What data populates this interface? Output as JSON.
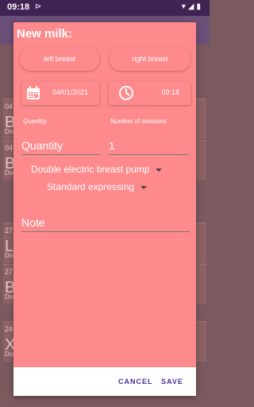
{
  "status": {
    "time": "09:18",
    "notif": "⊳"
  },
  "background_rows": [
    {
      "small": "04",
      "big": "B",
      "sub": "Dou"
    },
    {
      "small": "04",
      "big": "B",
      "sub": "Dou"
    },
    {
      "small": "27",
      "big": "L",
      "sub": "Dou"
    },
    {
      "small": "27",
      "big": "B",
      "sub": "Dou"
    },
    {
      "small": "24",
      "big": "X",
      "sub": "Dou"
    }
  ],
  "dialog": {
    "title": "New milk:",
    "left_breast": "left breast",
    "right_breast": "right breast",
    "date": "04/01/2021",
    "time": "09:18",
    "quantity_label": "Quantity",
    "sessions_label": "Number of sessions",
    "quantity_placeholder": "Quantity",
    "sessions_value": "1",
    "pump_selected": "Double electric breast pump",
    "mode_selected": "Standard expressing",
    "note_placeholder": "Note",
    "cancel": "CANCEL",
    "save": "SAVE"
  }
}
